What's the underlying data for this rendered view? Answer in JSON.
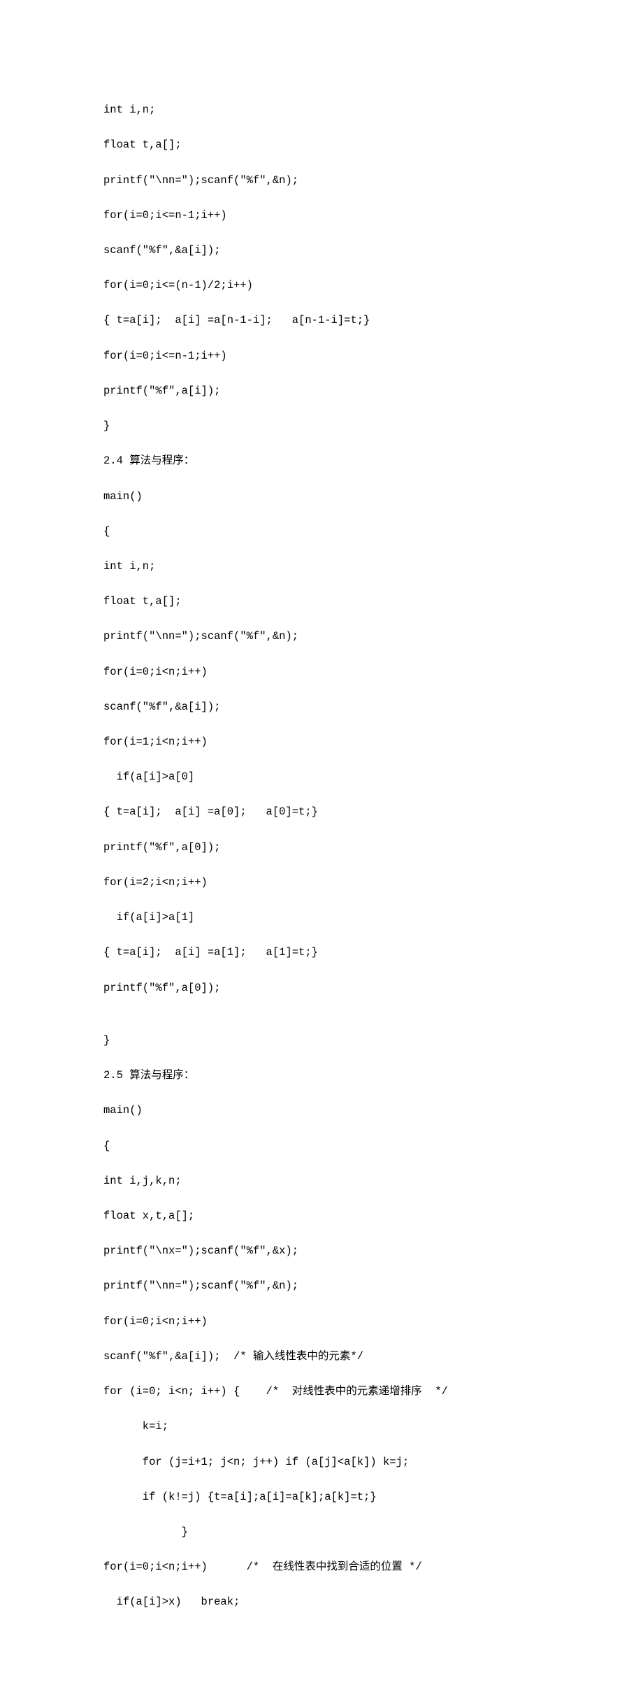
{
  "lines": [
    "int i,n;",
    "float t,a[];",
    "printf(\"\\nn=\");scanf(\"%f\",&n);",
    "for(i=0;i<=n-1;i++)",
    "scanf(\"%f\",&a[i]);",
    "for(i=0;i<=(n-1)/2;i++)",
    "{ t=a[i];  a[i] =a[n-1-i];   a[n-1-i]=t;}",
    "for(i=0;i<=n-1;i++)",
    "printf(\"%f\",a[i]);",
    "}",
    "2.4 算法与程序：",
    "main()",
    "{",
    "int i,n;",
    "float t,a[];",
    "printf(\"\\nn=\");scanf(\"%f\",&n);",
    "for(i=0;i<n;i++)",
    "scanf(\"%f\",&a[i]);",
    "for(i=1;i<n;i++)",
    "  if(a[i]>a[0]",
    "{ t=a[i];  a[i] =a[0];   a[0]=t;}",
    "printf(\"%f\",a[0]);",
    "for(i=2;i<n;i++)",
    "  if(a[i]>a[1]",
    "{ t=a[i];  a[i] =a[1];   a[1]=t;}",
    "printf(\"%f\",a[0]);",
    "",
    "}",
    "2.5 算法与程序：",
    "main()",
    "{",
    "int i,j,k,n;",
    "float x,t,a[];",
    "printf(\"\\nx=\");scanf(\"%f\",&x);",
    "printf(\"\\nn=\");scanf(\"%f\",&n);",
    "for(i=0;i<n;i++)",
    "scanf(\"%f\",&a[i]);  /* 输入线性表中的元素*/",
    "for (i=0; i<n; i++) {    /*  对线性表中的元素递增排序  */",
    "      k=i;",
    "      for (j=i+1; j<n; j++) if (a[j]<a[k]) k=j;",
    "      if (k!=j) {t=a[i];a[i]=a[k];a[k]=t;}",
    "            }",
    "for(i=0;i<n;i++)      /*  在线性表中找到合适的位置 */",
    "  if(a[i]>x)   break;"
  ]
}
